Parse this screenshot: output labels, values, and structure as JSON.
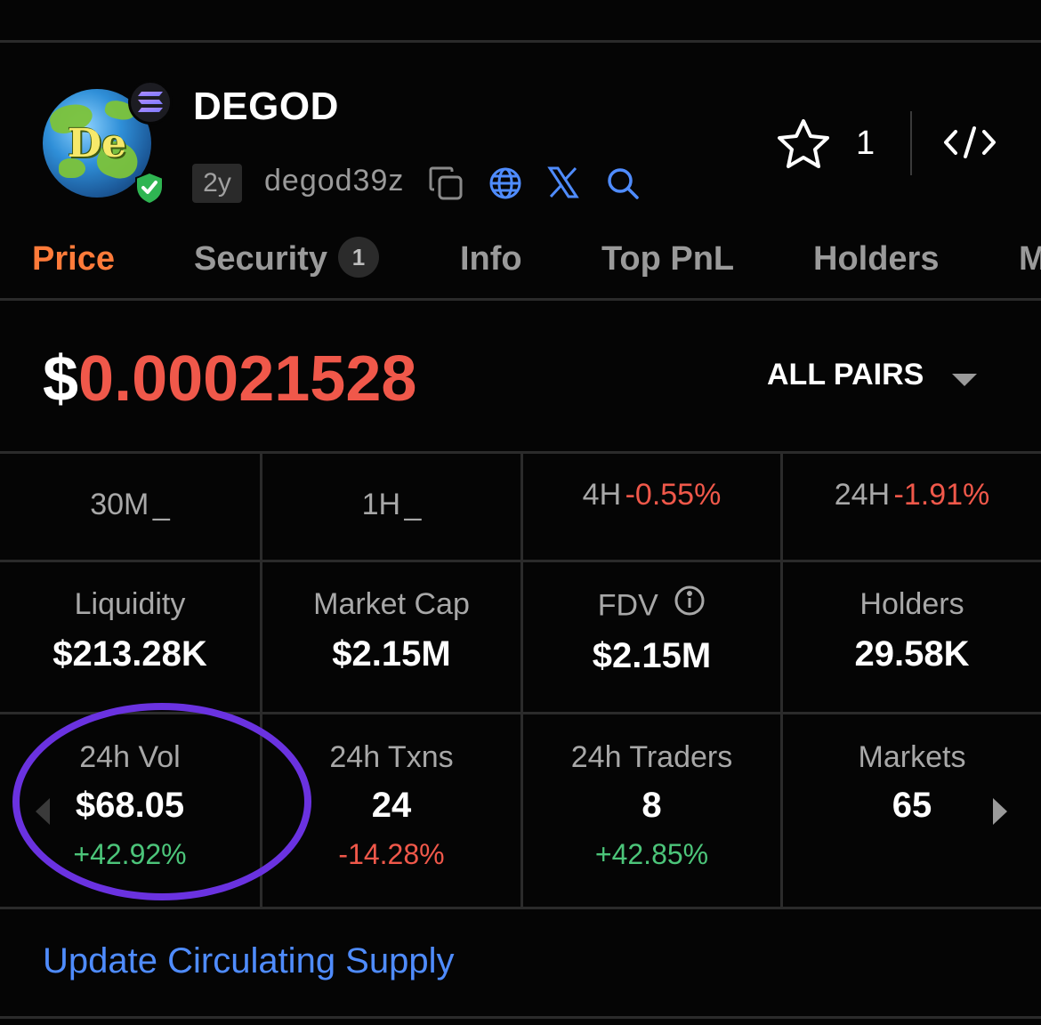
{
  "token": {
    "name": "DEGOD",
    "logo_text": "De",
    "age": "2y",
    "ticker": "degod39z"
  },
  "icons": {
    "chain": "solana-icon",
    "verified": "shield-check-icon",
    "copy": "copy-icon",
    "website": "globe-icon",
    "twitter": "x-icon",
    "search": "search-icon",
    "watchlist": "star-icon",
    "embed": "code-icon",
    "dropdown": "caret-down-icon"
  },
  "watchlist": {
    "count": "1"
  },
  "tabs": [
    {
      "label": "Price",
      "active": true
    },
    {
      "label": "Security",
      "badge": "1"
    },
    {
      "label": "Info"
    },
    {
      "label": "Top PnL"
    },
    {
      "label": "Holders"
    },
    {
      "label": "M"
    }
  ],
  "price": {
    "currency": "$",
    "value": "0.00021528"
  },
  "pairs": {
    "label": "ALL PAIRS"
  },
  "timeframes": [
    {
      "label": "30M",
      "change": "_"
    },
    {
      "label": "1H",
      "change": "_"
    },
    {
      "label": "4H",
      "change": "-0.55%"
    },
    {
      "label": "24H",
      "change": "-1.91%"
    }
  ],
  "metrics": [
    {
      "label": "Liquidity",
      "value": "$213.28K"
    },
    {
      "label": "Market Cap",
      "value": "$2.15M"
    },
    {
      "label": "FDV",
      "value": "$2.15M",
      "info": true
    },
    {
      "label": "Holders",
      "value": "29.58K"
    }
  ],
  "activity": [
    {
      "label": "24h Vol",
      "value": "$68.05",
      "change": "+42.92%"
    },
    {
      "label": "24h Txns",
      "value": "24",
      "change": "-14.28%"
    },
    {
      "label": "24h Traders",
      "value": "8",
      "change": "+42.85%"
    },
    {
      "label": "Markets",
      "value": "65"
    }
  ],
  "links": {
    "update_supply": "Update Circulating Supply"
  },
  "colors": {
    "background": "#050505",
    "accent_orange": "#ff7b3a",
    "negative": "#f0584a",
    "positive": "#4cc57a",
    "link": "#4f8cff",
    "annotation_circle": "#6a32e0"
  }
}
